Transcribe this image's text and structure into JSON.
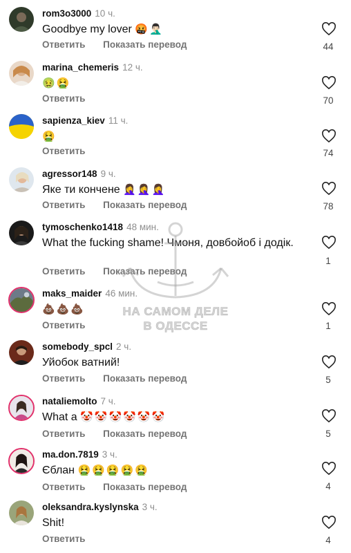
{
  "comments": [
    {
      "username": "rom3o3000",
      "time": "10 ч.",
      "text": "Goodbye my lover",
      "emojis": "🤬🤦🏻‍♂️",
      "reply_label": "Ответить",
      "translate_label": "Показать перевод",
      "likes": "44"
    },
    {
      "username": "marina_chemeris",
      "time": "12 ч.",
      "text": "",
      "emojis": "🤢🤮",
      "reply_label": "Ответить",
      "translate_label": "",
      "likes": "70"
    },
    {
      "username": "sapienza_kiev",
      "time": "11 ч.",
      "text": "",
      "emojis": "🤮",
      "reply_label": "Ответить",
      "translate_label": "",
      "likes": "74"
    },
    {
      "username": "agressor148",
      "time": "9 ч.",
      "text": "Яке ти кончене",
      "emojis": "🤦‍♀️🤦‍♀️🤦‍♀️",
      "reply_label": "Ответить",
      "translate_label": "Показать перевод",
      "likes": "78"
    },
    {
      "username": "tymoschenko1418",
      "time": "48 мин.",
      "text": "What the fucking shame! Чмоня, довбойоб і додік.",
      "emojis": "",
      "reply_label": "Ответить",
      "translate_label": "Показать перевод",
      "likes": "1"
    },
    {
      "username": "maks_maider",
      "time": "46 мин.",
      "text": "",
      "emojis": "💩💩💩",
      "reply_label": "Ответить",
      "translate_label": "",
      "likes": "1"
    },
    {
      "username": "somebody_spcl",
      "time": "2 ч.",
      "text": "Уйобок ватний!",
      "emojis": "",
      "reply_label": "Ответить",
      "translate_label": "Показать перевод",
      "likes": "5"
    },
    {
      "username": "nataliemolto",
      "time": "7 ч.",
      "text": "What a",
      "emojis": "🤡🤡🤡🤡🤡🤡",
      "reply_label": "Ответить",
      "translate_label": "Показать перевод",
      "likes": "5"
    },
    {
      "username": "ma.don.7819",
      "time": "3 ч.",
      "text": "Єблан",
      "emojis": "🤮🤮🤮🤮🤮",
      "reply_label": "Ответить",
      "translate_label": "Показать перевод",
      "likes": "4"
    },
    {
      "username": "oleksandra.kyslynska",
      "time": "3 ч.",
      "text": "Shit!",
      "emojis": "",
      "reply_label": "Ответить",
      "translate_label": "",
      "likes": "4"
    }
  ],
  "watermark": {
    "line1": "НА САМОМ ДЕЛЕ",
    "line2": "В ОДЕССЕ"
  },
  "colors": {
    "username": "#111111",
    "muted": "#737373",
    "heart_stroke": "#262626",
    "story_ring": "#e1306c"
  }
}
